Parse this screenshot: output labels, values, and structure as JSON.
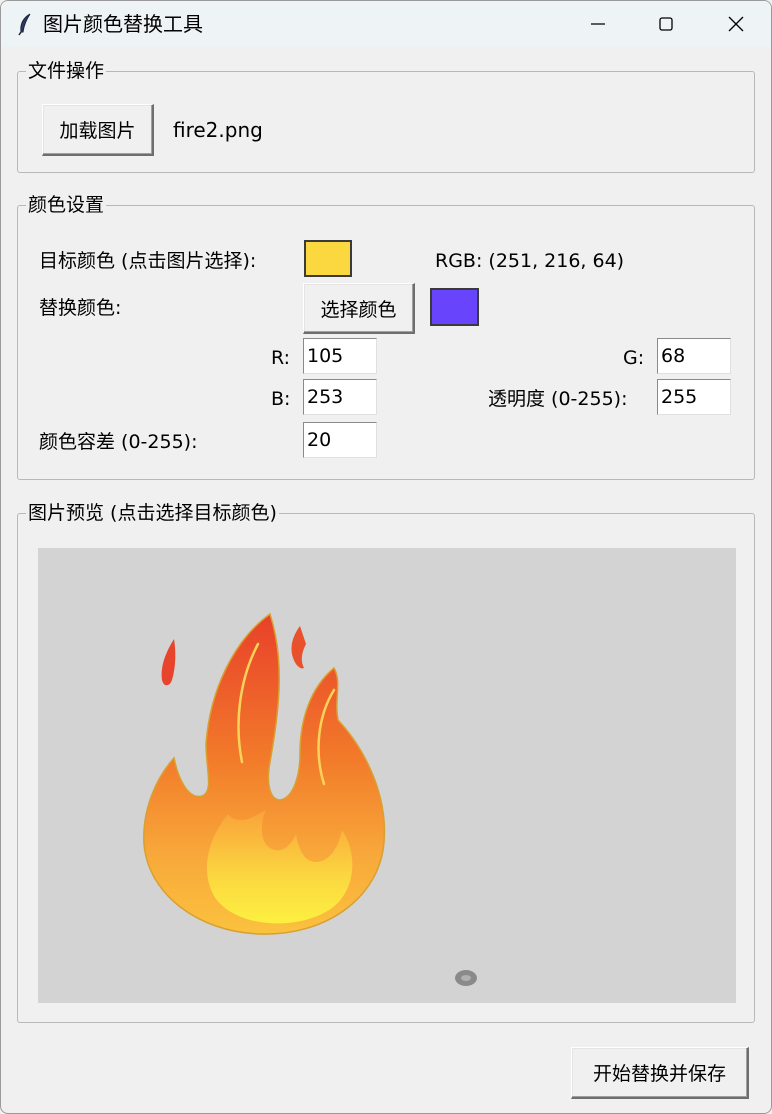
{
  "window": {
    "title": "图片颜色替换工具",
    "icon": "feather-icon",
    "controls": [
      "minimize-icon",
      "maximize-icon",
      "close-icon"
    ]
  },
  "file_section": {
    "legend": "文件操作",
    "load_button": "加载图片",
    "filename": "fire2.png"
  },
  "color_section": {
    "legend": "颜色设置",
    "target_label": "目标颜色 (点击图片选择):",
    "target_color": "#fbd840",
    "rgb_text": "RGB: (251, 216, 64)",
    "replace_label": "替换颜色:",
    "choose_button": "选择颜色",
    "replace_color": "#6944fd",
    "r_label": "R:",
    "r_value": "105",
    "g_label": "G:",
    "g_value": "68",
    "b_label": "B:",
    "b_value": "253",
    "alpha_label": "透明度 (0-255):",
    "alpha_value": "255",
    "tolerance_label": "颜色容差 (0-255):",
    "tolerance_value": "20"
  },
  "preview_section": {
    "legend": "图片预览 (点击选择目标颜色)",
    "canvas_bg": "#d3d3d3"
  },
  "actions": {
    "start_button": "开始替换并保存"
  }
}
